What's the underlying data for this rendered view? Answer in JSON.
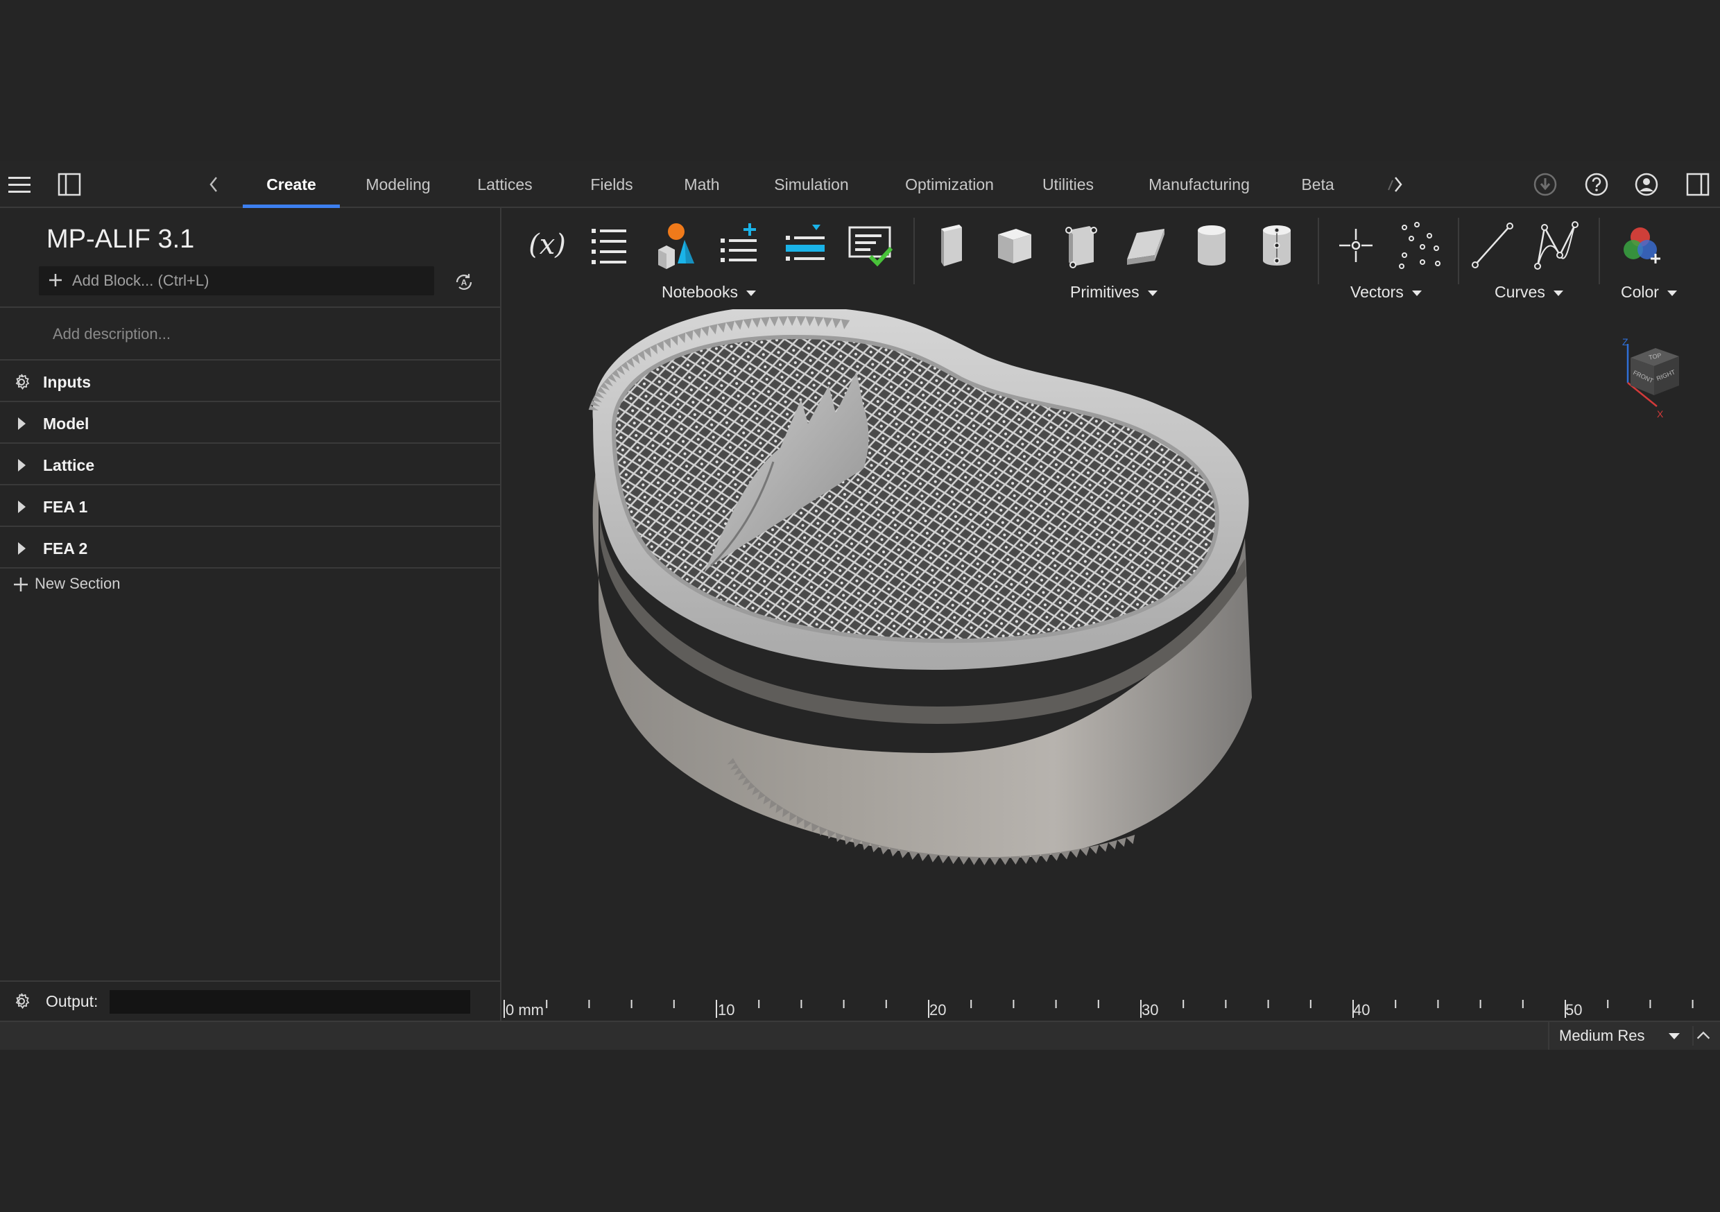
{
  "menubar": {
    "tabs": [
      {
        "label": "Create",
        "active": true
      },
      {
        "label": "Modeling"
      },
      {
        "label": "Lattices"
      },
      {
        "label": "Fields"
      },
      {
        "label": "Math"
      },
      {
        "label": "Simulation"
      },
      {
        "label": "Optimization"
      },
      {
        "label": "Utilities"
      },
      {
        "label": "Manufacturing"
      },
      {
        "label": "Beta"
      }
    ],
    "icons": [
      "hamburger-icon",
      "panel-toggle-icon",
      "chevron-left-icon",
      "chevron-right-icon",
      "download-icon",
      "help-icon",
      "user-icon",
      "panel-right-icon"
    ]
  },
  "notebook": {
    "title": "MP-ALIF 3.1",
    "add_block_placeholder": "Add Block... (Ctrl+L)",
    "description_placeholder": "Add description...",
    "sections": [
      {
        "label": "Inputs",
        "icon": "gear-icon"
      },
      {
        "label": "Model",
        "icon": "caret-right-icon"
      },
      {
        "label": "Lattice",
        "icon": "caret-right-icon"
      },
      {
        "label": "FEA 1",
        "icon": "caret-right-icon"
      },
      {
        "label": "FEA 2",
        "icon": "caret-right-icon"
      }
    ],
    "new_section_label": "New Section",
    "output_label": "Output:"
  },
  "ribbon": {
    "groups": [
      {
        "label": "Notebooks"
      },
      {
        "label": "Primitives"
      },
      {
        "label": "Vectors"
      },
      {
        "label": "Curves"
      },
      {
        "label": "Color"
      }
    ],
    "buttons": [
      "variable-icon",
      "list-icon",
      "shapes-icon",
      "add-list-icon",
      "insert-list-icon",
      "checklist-icon",
      "box-icon",
      "cube-icon",
      "box-points-icon",
      "parallelogram-icon",
      "cylinder-icon",
      "cylinder-points-icon",
      "point-icon",
      "point-cloud-icon",
      "line-icon",
      "polyline-icon",
      "color-icon"
    ]
  },
  "viewport": {
    "ruler_labels": [
      "0 mm",
      "10",
      "20",
      "30",
      "40",
      "50"
    ],
    "viewcube": {
      "top": "TOP",
      "front": "FRONT",
      "right": "RIGHT",
      "axis_z": "Z",
      "axis_x": "X"
    }
  },
  "statusbar": {
    "resolution": "Medium Res"
  },
  "colors": {
    "background": "#252525",
    "accent": "#3d7ff0",
    "model_grey": "#a9a9a9"
  }
}
